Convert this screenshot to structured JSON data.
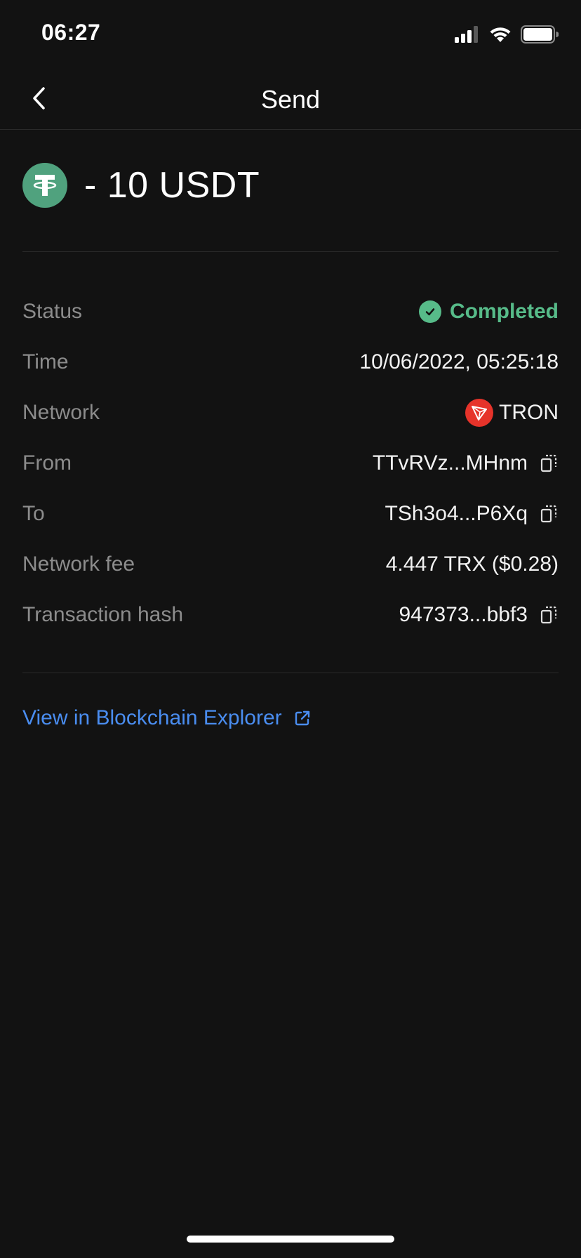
{
  "status_bar": {
    "time": "06:27"
  },
  "header": {
    "title": "Send"
  },
  "transaction": {
    "amount": "- 10 USDT",
    "token_color": "#50a27e"
  },
  "details": {
    "status": {
      "label": "Status",
      "value": "Completed",
      "color": "#57bb89"
    },
    "time": {
      "label": "Time",
      "value": "10/06/2022, 05:25:18"
    },
    "network": {
      "label": "Network",
      "value": "TRON",
      "icon_color": "#e6332a"
    },
    "from": {
      "label": "From",
      "value": "TTvRVz...MHnm"
    },
    "to": {
      "label": "To",
      "value": "TSh3o4...P6Xq"
    },
    "fee": {
      "label": "Network fee",
      "value": "4.447 TRX ($0.28)"
    },
    "hash": {
      "label": "Transaction hash",
      "value": "947373...bbf3"
    }
  },
  "explorer": {
    "label": "View in Blockchain Explorer",
    "color": "#4a8df0"
  }
}
